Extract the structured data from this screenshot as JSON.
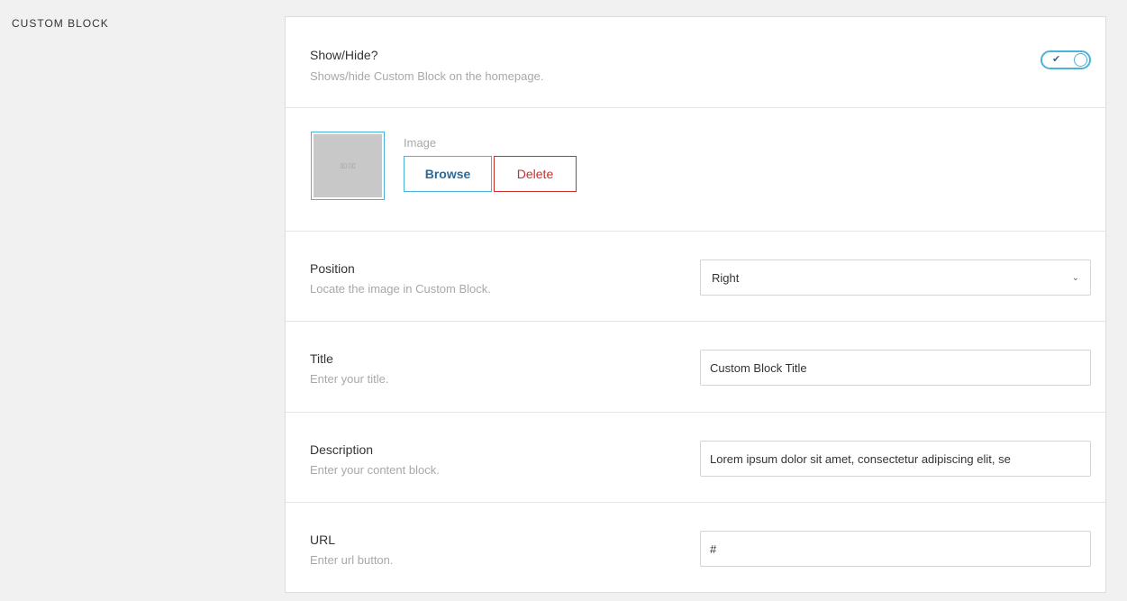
{
  "section": {
    "label": "CUSTOM BLOCK"
  },
  "show_hide": {
    "label": "Show/Hide?",
    "description": "Shows/hide Custom Block on the homepage.",
    "toggle_on": true
  },
  "image": {
    "label": "Image",
    "browse_label": "Browse",
    "delete_label": "Delete"
  },
  "position": {
    "label": "Position",
    "description": "Locate the image in Custom Block.",
    "selected": "Right"
  },
  "title": {
    "label": "Title",
    "description": "Enter your title.",
    "value": "Custom Block Title"
  },
  "description": {
    "label": "Description",
    "description": "Enter your content block.",
    "value": "Lorem ipsum dolor sit amet, consectetur adipiscing elit, se"
  },
  "url": {
    "label": "URL",
    "description": "Enter url button.",
    "value": "#"
  },
  "colors": {
    "accent": "#4ab3d8",
    "danger": "#c9302c"
  }
}
